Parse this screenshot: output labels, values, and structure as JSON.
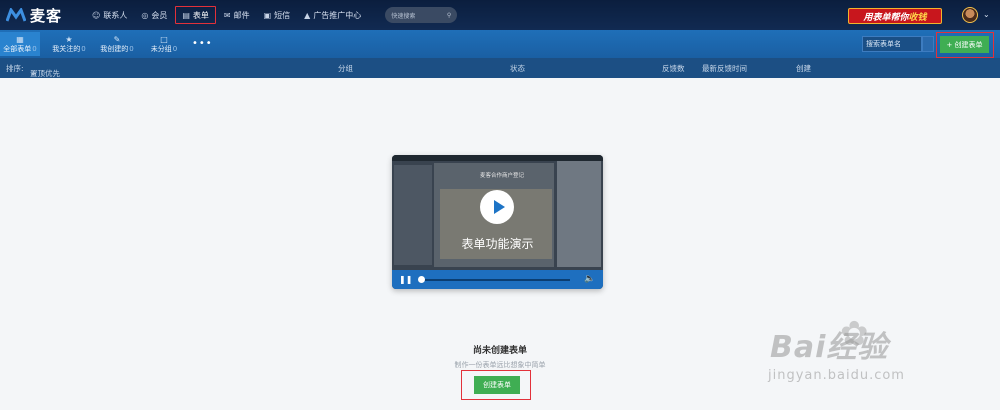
{
  "app": {
    "name": "麦客"
  },
  "topnav": {
    "items": [
      {
        "icon": "user-icon",
        "label": "联系人"
      },
      {
        "icon": "vip-icon",
        "label": "会员"
      },
      {
        "icon": "form-icon",
        "label": "表单",
        "active": true
      },
      {
        "icon": "mail-icon",
        "label": "邮件"
      },
      {
        "icon": "sms-icon",
        "label": "短信"
      },
      {
        "icon": "ad-icon",
        "label": "广告推广中心"
      }
    ],
    "search_placeholder": "快速搜索",
    "promo": {
      "text1": "用表单帮你",
      "text2": "收钱"
    }
  },
  "subbar": {
    "tabs": [
      {
        "label": "全部表单",
        "count": "0",
        "active": true
      },
      {
        "label": "我关注的",
        "count": "0"
      },
      {
        "label": "我创建的",
        "count": "0"
      },
      {
        "label": "未分组",
        "count": "0"
      }
    ],
    "more": "•••",
    "search_placeholder": "搜索表单名",
    "create_label": "+ 创建表单"
  },
  "table_header": {
    "sort_label": "排序:",
    "sort_value": "置顶优先",
    "columns": [
      "分组",
      "状态",
      "反馈数",
      "最新反馈时间",
      "创建"
    ]
  },
  "video": {
    "heading": "麦客合作商户登记",
    "caption": "表单功能演示"
  },
  "empty_state": {
    "title": "尚未创建表单",
    "subtitle": "制作一份表单远比想象中简单",
    "button": "创建表单"
  },
  "watermark": {
    "brand": "Bai经验",
    "url": "jingyan.baidu.com"
  },
  "colors": {
    "topbar": "#0b1e3e",
    "subbar": "#1f6fb8",
    "accent_green": "#3fae53",
    "highlight_red": "#e2313a"
  }
}
